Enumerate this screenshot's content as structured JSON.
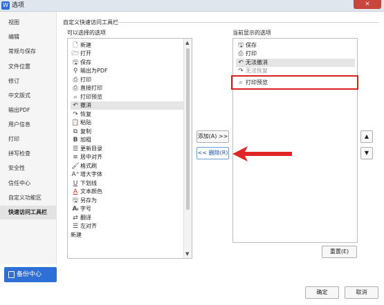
{
  "window": {
    "title": "选项",
    "close": "×"
  },
  "sidebar": {
    "items": [
      {
        "label": "视图"
      },
      {
        "label": "编辑"
      },
      {
        "label": "常规与保存"
      },
      {
        "label": "文件位置"
      },
      {
        "label": "修订"
      },
      {
        "label": "中文版式"
      },
      {
        "label": "输出PDF"
      },
      {
        "label": "用户信息"
      },
      {
        "label": "打印"
      },
      {
        "label": "拼写检查"
      },
      {
        "label": "安全性"
      },
      {
        "label": "信任中心"
      },
      {
        "label": "自定义功能区"
      },
      {
        "label": "快速访问工具栏"
      }
    ],
    "active": "快速访问工具栏",
    "backup_label": "备份中心"
  },
  "main": {
    "section_title": "自定义快速访问工具栏",
    "available_label": "可以选择的选项",
    "current_label": "当前显示的选项",
    "available_items": [
      {
        "label": "新建",
        "icon": "new-doc-icon"
      },
      {
        "label": "打开",
        "icon": "folder-icon"
      },
      {
        "label": "保存",
        "icon": "save-icon"
      },
      {
        "label": "输出为PDF",
        "icon": "pdf-icon"
      },
      {
        "label": "打印",
        "icon": "print-icon"
      },
      {
        "label": "直接打印",
        "icon": "direct-print-icon"
      },
      {
        "label": "打印预览",
        "icon": "print-preview-icon"
      },
      {
        "label": "撤消",
        "icon": "undo-icon",
        "selected": true
      },
      {
        "label": "恢复",
        "icon": "redo-icon"
      },
      {
        "label": "粘贴",
        "icon": "paste-icon"
      },
      {
        "label": "复制",
        "icon": "copy-icon"
      },
      {
        "label": "加粗",
        "icon": "bold-icon"
      },
      {
        "label": "更新目录",
        "icon": "update-toc-icon"
      },
      {
        "label": "居中对齐",
        "icon": "align-center-icon"
      },
      {
        "label": "格式刷",
        "icon": "format-painter-icon"
      },
      {
        "label": "增大字体",
        "icon": "grow-font-icon"
      },
      {
        "label": "下划线",
        "icon": "underline-icon"
      },
      {
        "label": "文本颜色",
        "icon": "text-color-icon"
      },
      {
        "label": "另存为",
        "icon": "save-as-icon"
      },
      {
        "label": "字号",
        "icon": "font-size-icon"
      },
      {
        "label": "翻译",
        "icon": "translate-icon"
      },
      {
        "label": "左对齐",
        "icon": "align-left-icon"
      }
    ],
    "group_label": "新建",
    "current_items": [
      {
        "label": "保存",
        "icon": "save-icon"
      },
      {
        "label": "打印",
        "icon": "print-icon"
      },
      {
        "label": "无法撤消",
        "icon": "undo-icon",
        "selected": true
      },
      {
        "label": "无法恢复",
        "icon": "redo-icon",
        "ghost": true
      },
      {
        "label": "打印预览",
        "icon": "print-preview-icon"
      }
    ],
    "add_button": "添加(A) >>",
    "remove_button": "<< 删除(R)",
    "reset_button": "重置(E)",
    "up_glyph": "▲",
    "down_glyph": "▼"
  },
  "footer": {
    "ok": "确定",
    "cancel": "取消"
  },
  "colors": {
    "accent": "#2d6fd6",
    "highlight": "#d9201f"
  }
}
